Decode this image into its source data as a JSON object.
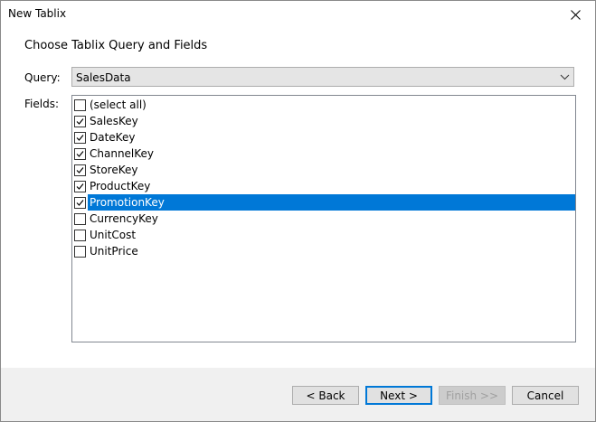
{
  "window": {
    "title": "New Tablix"
  },
  "heading": "Choose Tablix Query and Fields",
  "query": {
    "label": "Query:",
    "value": "SalesData"
  },
  "fields": {
    "label": "Fields:",
    "items": [
      {
        "label": "(select all)",
        "checked": false,
        "selected": false
      },
      {
        "label": "SalesKey",
        "checked": true,
        "selected": false
      },
      {
        "label": "DateKey",
        "checked": true,
        "selected": false
      },
      {
        "label": "ChannelKey",
        "checked": true,
        "selected": false
      },
      {
        "label": "StoreKey",
        "checked": true,
        "selected": false
      },
      {
        "label": "ProductKey",
        "checked": true,
        "selected": false
      },
      {
        "label": "PromotionKey",
        "checked": true,
        "selected": true
      },
      {
        "label": "CurrencyKey",
        "checked": false,
        "selected": false
      },
      {
        "label": "UnitCost",
        "checked": false,
        "selected": false
      },
      {
        "label": "UnitPrice",
        "checked": false,
        "selected": false
      }
    ]
  },
  "buttons": {
    "back": "< Back",
    "next": "Next >",
    "finish": "Finish >>",
    "cancel": "Cancel"
  },
  "colors": {
    "selection": "#0078d7",
    "footer_bg": "#f0f0f0"
  }
}
